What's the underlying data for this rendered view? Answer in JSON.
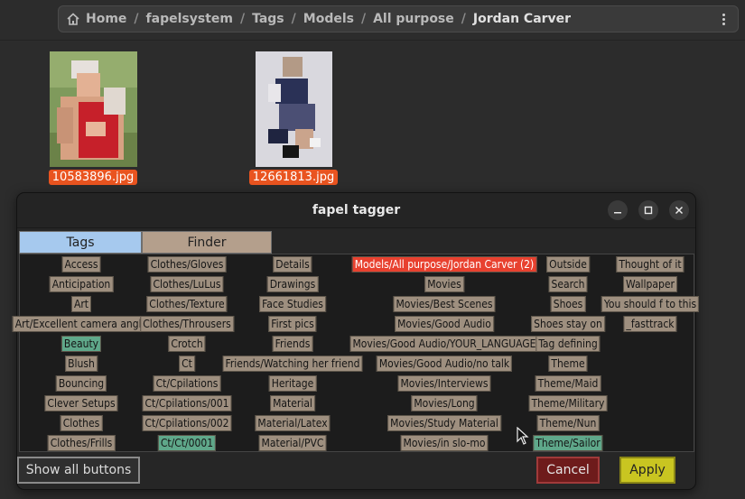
{
  "breadcrumb": {
    "items": [
      "Home",
      "fapelsystem",
      "Tags",
      "Models",
      "All purpose",
      "Jordan Carver"
    ],
    "separator": "/"
  },
  "files": [
    {
      "name": "10583896.jpg"
    },
    {
      "name": "12661813.jpg"
    }
  ],
  "dialog": {
    "title": "fapel tagger",
    "tabs": [
      "Tags",
      "Finder"
    ],
    "buttons": {
      "show_all": "Show all buttons",
      "cancel": "Cancel",
      "apply": "Apply"
    }
  },
  "tag_columns": [
    [
      "Access",
      "Anticipation",
      "Art",
      "Art/Excellent camera angle",
      "Beauty",
      "Blush",
      "Bouncing",
      "Clever Setups",
      "Clothes",
      "Clothes/Frills"
    ],
    [
      "Clothes/Gloves",
      "Clothes/LuLus",
      "Clothes/Texture",
      "Clothes/Throusers",
      "Crotch",
      "Ct",
      "Ct/Cpilations",
      "Ct/Cpilations/001",
      "Ct/Cpilations/002",
      "Ct/Ct/0001"
    ],
    [
      "Details",
      "Drawings",
      "Face Studies",
      "First pics",
      "Friends",
      "Friends/Watching her friend",
      "Heritage",
      "Material",
      "Material/Latex",
      "Material/PVC"
    ],
    [
      "Models/All purpose/Jordan Carver (2)",
      "Movies",
      "Movies/Best Scenes",
      "Movies/Good Audio",
      "Movies/Good Audio/YOUR_LANGUAGE",
      "Movies/Good Audio/no talk",
      "Movies/Interviews",
      "Movies/Long",
      "Movies/Study Material",
      "Movies/in slo-mo"
    ],
    [
      "Outside",
      "Search",
      "Shoes",
      "Shoes stay on",
      "Tag defining",
      "Theme",
      "Theme/Maid",
      "Theme/Military",
      "Theme/Nun",
      "Theme/Sailor"
    ],
    [
      "Thought of it",
      "Wallpaper",
      "You should f to this",
      "_fasttrack"
    ]
  ],
  "tag_states": {
    "selected_green": [
      "Beauty",
      "Ct/Ct/0001",
      "Theme/Sailor"
    ],
    "highlighted_red": [
      "Models/All purpose/Jordan Carver (2)"
    ]
  },
  "colors": {
    "tag_bg": "#9e8f7f",
    "tag_selected": "#5fa88a",
    "tag_current": "#e8412f",
    "file_label": "#e95420",
    "tab_active": "#a6c9ee",
    "tab_inactive": "#b49f8c",
    "apply": "#c9c521",
    "cancel": "#6e1b1b"
  },
  "icons": {
    "home": "home-icon",
    "menu": "kebab-menu-icon",
    "minimize": "minimize-icon",
    "maximize": "maximize-icon",
    "close": "close-icon",
    "cursor": "mouse-pointer-icon"
  }
}
